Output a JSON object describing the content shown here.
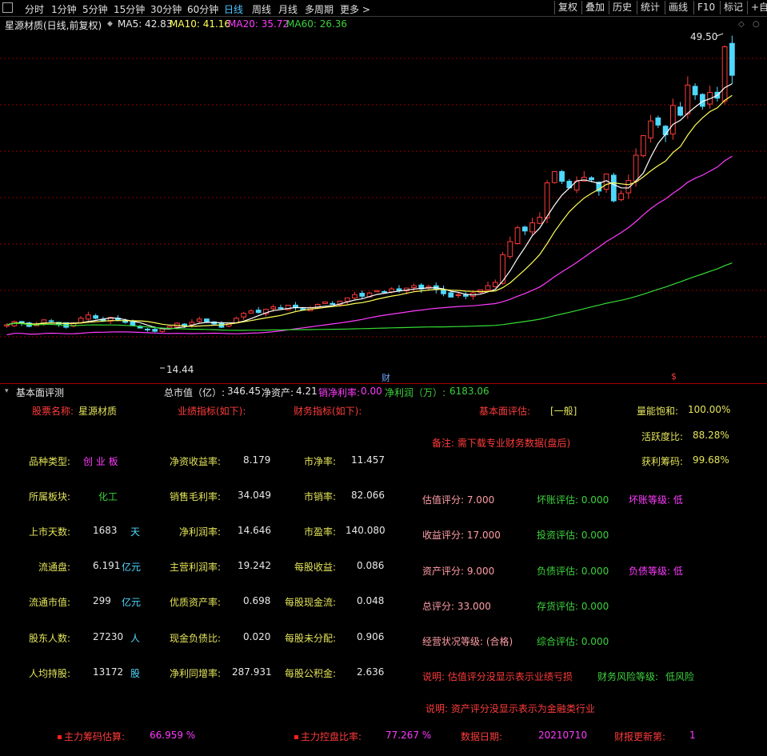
{
  "toolbar": {
    "tabs": [
      "分时",
      "1分钟",
      "5分钟",
      "15分钟",
      "30分钟",
      "60分钟",
      "日线",
      "周线",
      "月线",
      "多周期",
      "更多 >"
    ],
    "active_tab": "日线",
    "right_buttons": [
      "复权",
      "叠加",
      "历史",
      "统计",
      "画线",
      "F10",
      "标记",
      "+自"
    ]
  },
  "chart": {
    "title": "星源材质(日线,前复权)",
    "ma5": "MA5: 42.83",
    "ma10": "MA10: 41.16",
    "ma20": "MA20: 35.72",
    "ma60": "MA60: 26.36",
    "high_label": "49.50",
    "low_label": "14.44",
    "marker_cai": "财",
    "marker_s": "$",
    "colors": {
      "up": "#ff3b3b",
      "down": "#4fd8ff",
      "ma5": "#ffffff",
      "ma10": "#ffff55",
      "ma20": "#ff3bff",
      "ma60": "#33dd33",
      "grid": "#8a0000"
    },
    "price_range": [
      10,
      52
    ],
    "closes": [
      15.4,
      15.8,
      15.6,
      15.2,
      15.5,
      16.0,
      15.8,
      15.5,
      15.1,
      15.6,
      16.2,
      16.6,
      16.2,
      15.9,
      16.3,
      16.0,
      15.7,
      15.3,
      15.0,
      14.8,
      14.6,
      14.9,
      15.2,
      15.6,
      15.3,
      15.7,
      16.1,
      15.8,
      15.5,
      15.1,
      15.6,
      16.2,
      16.8,
      17.1,
      16.9,
      17.3,
      17.6,
      17.4,
      17.8,
      17.5,
      17.2,
      17.5,
      17.9,
      18.2,
      17.9,
      18.3,
      18.7,
      19.1,
      18.9,
      19.3,
      19.6,
      19.4,
      19.8,
      19.6,
      19.9,
      20.2,
      19.8,
      20.1,
      19.7,
      19.2,
      18.8,
      19.1,
      18.9,
      19.3,
      19.7,
      20.2,
      20.6,
      24.0,
      25.6,
      27.3,
      26.9,
      27.9,
      28.6,
      32.8,
      34.2,
      33.0,
      32.2,
      33.0,
      33.5,
      33.2,
      31.8,
      33.9,
      30.6,
      31.5,
      33.1,
      36.2,
      38.6,
      40.4,
      39.9,
      38.7,
      42.3,
      41.1,
      44.8,
      43.6,
      42.2,
      43.9,
      43.2,
      49.5,
      46.0
    ]
  },
  "panel": {
    "title": "基本面评测",
    "summary": [
      {
        "label": "总市值（亿）:",
        "value": "346.45"
      },
      {
        "label": "净资产:",
        "value": "4.21"
      },
      {
        "label": "销净利率:",
        "value": "0.00"
      },
      {
        "label": "净利润（万）:",
        "value": "6183.06"
      }
    ],
    "stock_name_label": "股票名称:",
    "stock_name": "星源材质",
    "perf_label": "业绩指标(如下):",
    "fin_label": "财务指标(如下):",
    "fund_eval_label": "基本面评估:",
    "fund_eval_value": "[一般]",
    "note": "备注: 需下载专业财务数据(盘后)",
    "sat_label": "量能饱和:",
    "sat_value": "100.00%",
    "act_label": "活跃度比:",
    "act_value": "88.28%",
    "profit_label": "获利筹码:",
    "profit_value": "99.68%",
    "left_rows": [
      {
        "label": "品种类型:",
        "value": "创 业 板",
        "unit": ""
      },
      {
        "label": "所属板块:",
        "value": "化工",
        "unit": ""
      },
      {
        "label": "上市天数:",
        "value": "1683",
        "unit": "天"
      },
      {
        "label": "流通盘:",
        "value": "6.191",
        "unit": "亿元"
      },
      {
        "label": "流通市值:",
        "value": "299",
        "unit": "亿元"
      },
      {
        "label": "股东人数:",
        "value": "27230",
        "unit": "人"
      },
      {
        "label": "人均持股:",
        "value": "13172",
        "unit": "股"
      }
    ],
    "mid_rows": [
      {
        "label": "净资收益率:",
        "value": "8.179"
      },
      {
        "label": "销售毛利率:",
        "value": "34.049"
      },
      {
        "label": "净利润率:",
        "value": "14.646"
      },
      {
        "label": "主营利润率:",
        "value": "19.242"
      },
      {
        "label": "优质资产率:",
        "value": "0.698"
      },
      {
        "label": "现金负债比:",
        "value": "0.020"
      },
      {
        "label": "净利同增率:",
        "value": "287.931"
      }
    ],
    "fin_rows": [
      {
        "label": "市净率:",
        "value": "11.457"
      },
      {
        "label": "市销率:",
        "value": "82.066"
      },
      {
        "label": "市盈率:",
        "value": "140.080"
      },
      {
        "label": "每股收益:",
        "value": "0.086"
      },
      {
        "label": "每股现金流:",
        "value": "0.048"
      },
      {
        "label": "每股未分配:",
        "value": "0.906"
      },
      {
        "label": "每股公积金:",
        "value": "2.636"
      }
    ],
    "score_rows": [
      {
        "text": "估值评分: 7.000"
      },
      {
        "text": "收益评分: 17.000"
      },
      {
        "text": "资产评分: 9.000"
      },
      {
        "text": "总评分: 33.000"
      },
      {
        "text": "经营状况等级: (合格)"
      }
    ],
    "eval_rows": [
      {
        "text": "坏账评估: 0.000"
      },
      {
        "text": "投资评估: 0.000"
      },
      {
        "text": "负债评估: 0.000"
      },
      {
        "text": "存货评估: 0.000"
      },
      {
        "text": "综合评估: 0.000"
      }
    ],
    "grade_rows": [
      {
        "text": "坏账等级: 低"
      },
      {
        "text": "负债等级: 低"
      }
    ],
    "explain1": "说明: 估值评分没显示表示业绩亏损",
    "risk_label": "财务风险等级:",
    "risk_value": "低风险",
    "explain2": "说明: 资产评分没显示表示为金融类行业",
    "footer": {
      "main_cost_label": "主力筹码估算:",
      "main_cost_value": "66.959 %",
      "main_ctrl_label": "主力控盘比率:",
      "main_ctrl_value": "77.267 %",
      "date_label": "数据日期:",
      "date_value": "20210710",
      "report_label": "财报更新第:",
      "report_value": "1"
    }
  }
}
